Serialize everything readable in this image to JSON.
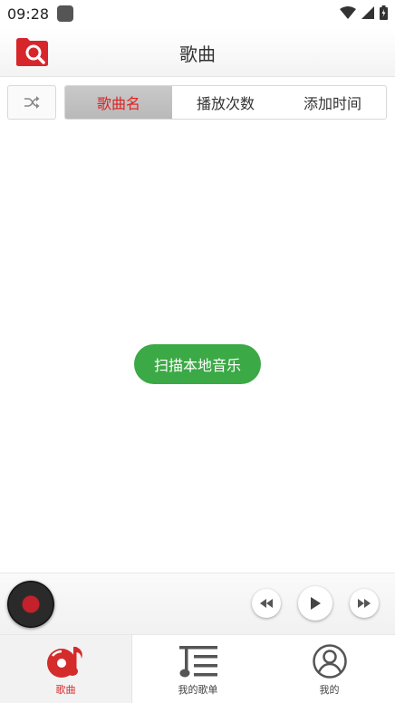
{
  "status_bar": {
    "time": "09:28"
  },
  "header": {
    "title": "歌曲"
  },
  "sort_options": [
    "歌曲名",
    "播放次数",
    "添加时间"
  ],
  "scan_button": {
    "label": "扫描本地音乐"
  },
  "tabs": [
    {
      "label": "歌曲",
      "icon": "songs-icon"
    },
    {
      "label": "我的歌单",
      "icon": "playlist-icon"
    },
    {
      "label": "我的",
      "icon": "profile-icon"
    }
  ],
  "colors": {
    "accent": "#d42b2b",
    "scan_button": "#3ba945",
    "segment_active_bg": "#c2c2c2"
  }
}
